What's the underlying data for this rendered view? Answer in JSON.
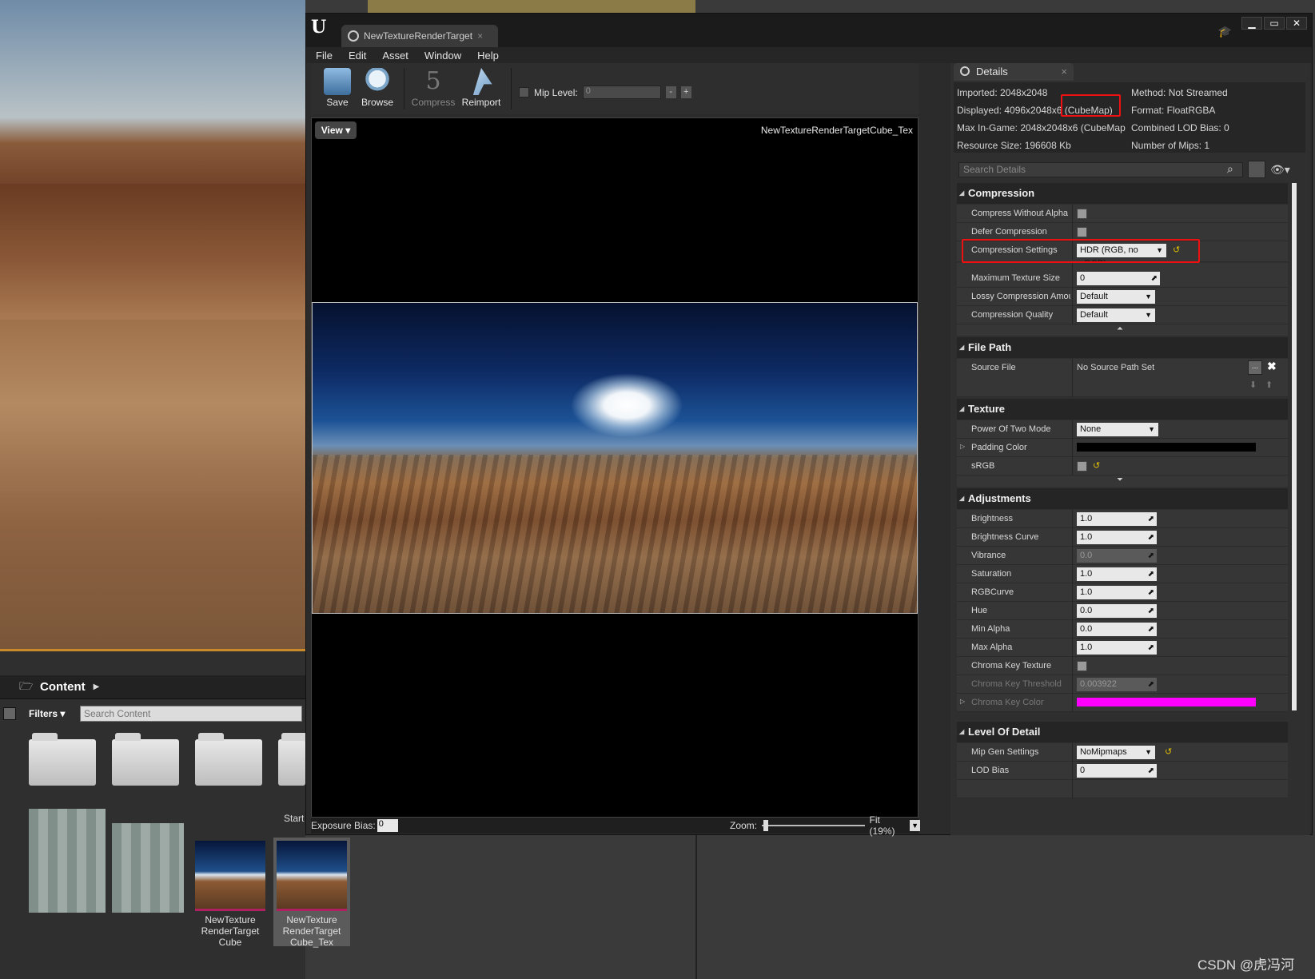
{
  "editor": {
    "tab_title": "NewTextureRenderTarget",
    "tab_close": "×",
    "menu": [
      "File",
      "Edit",
      "Asset",
      "Window",
      "Help"
    ],
    "window_buttons": [
      "▁",
      "▭",
      "✕"
    ]
  },
  "toolbar": {
    "save": "Save",
    "browse": "Browse",
    "compress": "Compress",
    "reimport": "Reimport",
    "mip_level_label": "Mip Level:",
    "mip_level_value": "0",
    "minus": "-",
    "plus": "+"
  },
  "viewport": {
    "view_button": "View",
    "asset_name": "NewTextureRenderTargetCube_Tex",
    "exposure_label": "Exposure Bias:",
    "exposure_value": "0",
    "zoom_label": "Zoom:",
    "zoom_value": "Fit (19%)"
  },
  "details": {
    "tab_label": "Details",
    "tab_close": "×",
    "info": {
      "imported": "Imported: 2048x2048",
      "displayed": "Displayed: 4096x2048x6 (CubeMap)",
      "max_in_game": "Max In-Game: 2048x2048x6 (CubeMap",
      "resource_size": "Resource Size: 196608 Kb",
      "method": "Method: Not Streamed",
      "format": "Format: FloatRGBA",
      "combined_lod": "Combined LOD Bias: 0",
      "num_mips": "Number of Mips: 1"
    },
    "search_placeholder": "Search Details",
    "categories": {
      "compression": "Compression",
      "file_path": "File Path",
      "texture": "Texture",
      "adjustments": "Adjustments",
      "lod": "Level Of Detail"
    },
    "compression": {
      "compress_without_alpha": "Compress Without Alpha",
      "defer_compression": "Defer Compression",
      "compression_settings": "Compression Settings",
      "compression_settings_value": "HDR (RGB, no sRGB)",
      "max_texture_size": "Maximum Texture Size",
      "max_texture_size_value": "0",
      "lossy_compression": "Lossy Compression Amou",
      "lossy_compression_value": "Default",
      "compression_quality": "Compression Quality",
      "compression_quality_value": "Default"
    },
    "file_path": {
      "source_file": "Source File",
      "source_file_value": "No Source Path Set",
      "more": "...",
      "clear": "✖"
    },
    "texture": {
      "power_of_two": "Power Of Two Mode",
      "power_of_two_value": "None",
      "padding_color": "Padding Color",
      "padding_color_hex": "#000000",
      "srgb": "sRGB"
    },
    "adjustments": [
      {
        "name": "Brightness",
        "value": "1.0",
        "disabled": false
      },
      {
        "name": "Brightness Curve",
        "value": "1.0",
        "disabled": false
      },
      {
        "name": "Vibrance",
        "value": "0.0",
        "disabled": true
      },
      {
        "name": "Saturation",
        "value": "1.0",
        "disabled": false
      },
      {
        "name": "RGBCurve",
        "value": "1.0",
        "disabled": false
      },
      {
        "name": "Hue",
        "value": "0.0",
        "disabled": false
      },
      {
        "name": "Min Alpha",
        "value": "0.0",
        "disabled": false
      },
      {
        "name": "Max Alpha",
        "value": "1.0",
        "disabled": false
      }
    ],
    "chroma": {
      "chroma_key_texture": "Chroma Key Texture",
      "chroma_key_threshold": "Chroma Key Threshold",
      "chroma_key_threshold_value": "0.003922",
      "chroma_key_color": "Chroma Key Color",
      "chroma_key_color_hex": "#ff00ff"
    },
    "lod": {
      "mip_gen_settings": "Mip Gen Settings",
      "mip_gen_settings_value": "NoMipmaps",
      "lod_bias": "LOD Bias",
      "lod_bias_value": "0"
    }
  },
  "content_browser": {
    "path": "Content",
    "filters": "Filters",
    "search_placeholder": "Search Content",
    "start_label": "Start",
    "assets": [
      {
        "label": "NewTexture RenderTarget Cube"
      },
      {
        "label": "NewTexture RenderTarget Cube_Tex"
      }
    ]
  },
  "watermark": "CSDN @虎冯河",
  "colors": {
    "highlight_red": "#e11111",
    "chroma_magenta": "#ff00ff",
    "reset_arrow_yellow": "#e0c000"
  }
}
